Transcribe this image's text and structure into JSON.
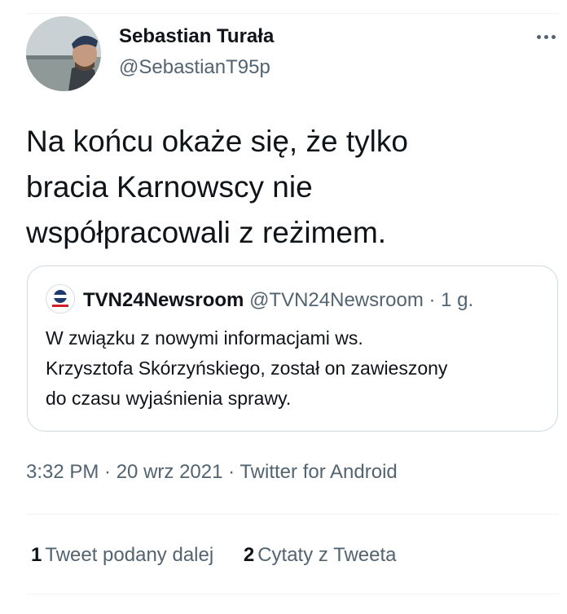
{
  "author": {
    "name": "Sebastian Turała",
    "handle": "@SebastianT95p"
  },
  "tweet": {
    "lines": [
      "Na końcu okaże się, że tylko",
      "bracia Karnowscy nie",
      "współpracowali z reżimem."
    ]
  },
  "quoted": {
    "name": "TVN24Newsroom",
    "handle": "@TVN24Newsroom",
    "separator": "·",
    "time": "1 g.",
    "lines": [
      "W związku z nowymi informacjami ws.",
      "Krzysztofa Skórzyńskiego, został on zawieszony",
      "do czasu wyjaśnienia sprawy."
    ]
  },
  "meta": {
    "text": "3:32 PM · 20 wrz 2021 · Twitter for Android"
  },
  "stats": {
    "retweets_count": "1",
    "retweets_label": "Tweet podany dalej",
    "quotes_count": "2",
    "quotes_label": "Cytaty z Tweeta"
  },
  "icons": {
    "more": "more-horizontal-icon",
    "avatar": "user-avatar",
    "quoted_avatar": "tvn24-logo"
  },
  "colors": {
    "text": "#0f1419",
    "secondary": "#536471",
    "border": "#cfd9de",
    "divider": "#eff3f4"
  }
}
